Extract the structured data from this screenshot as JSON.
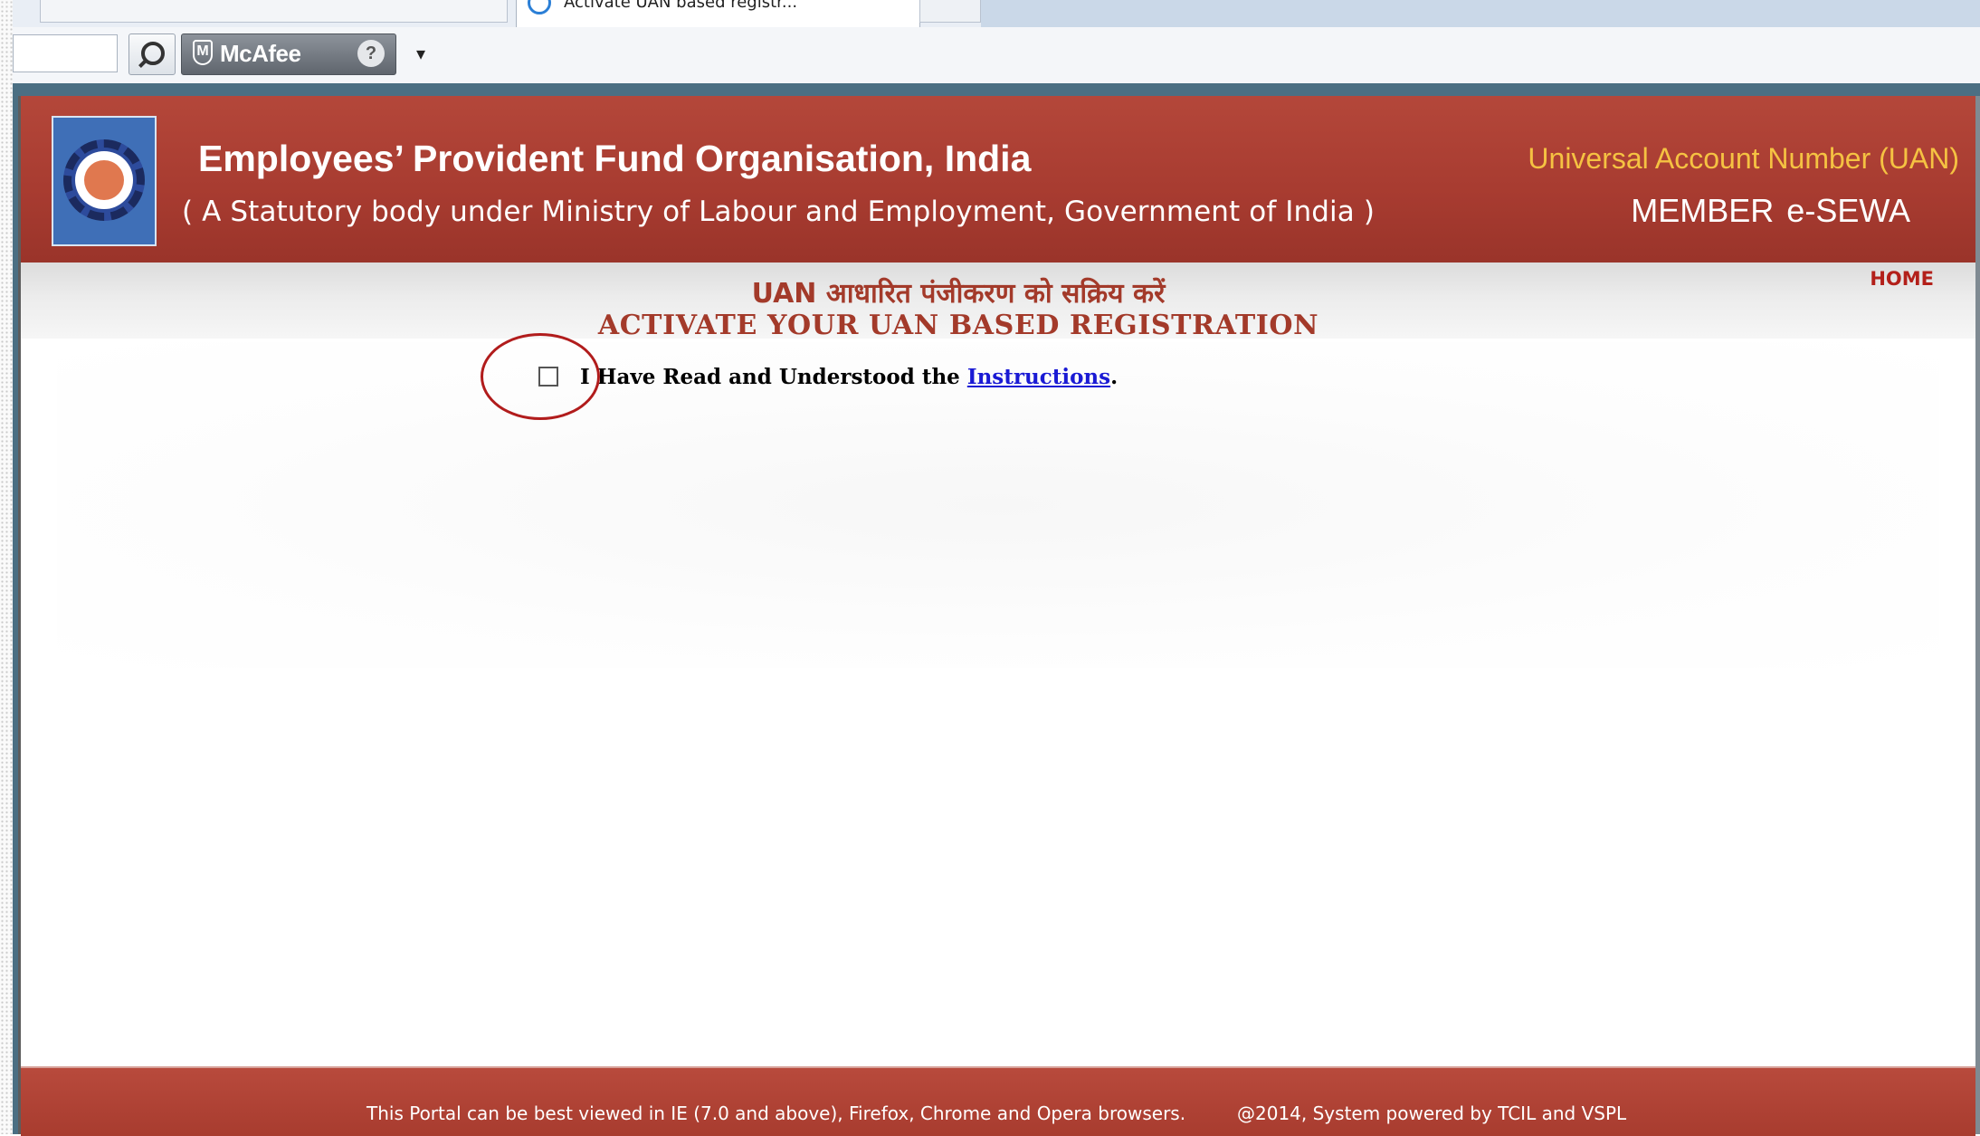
{
  "browser": {
    "active_tab_title": "Activate UAN based registr...",
    "toolbar": {
      "search_icon": "search-icon",
      "mcafee_label": "McAfee",
      "mcafee_shield": "M",
      "help_symbol": "?",
      "dropdown_symbol": "▾"
    }
  },
  "header": {
    "org_title": "Employees’ Provident Fund Organisation, India",
    "org_subtitle": "( A Statutory body under Ministry of Labour and Employment, Government of India )",
    "uan_label": "Universal Account Number (UAN)",
    "esewa_label": "MEMBER  e-SEWA"
  },
  "banner": {
    "hindi_heading": "UAN आधारित पंजीकरण को सक्रिय करें",
    "english_heading": "ACTIVATE YOUR UAN BASED REGISTRATION",
    "home_link": "HOME"
  },
  "form": {
    "agree_prefix": "I Have Read and Understood the ",
    "instructions_link": "Instructions",
    "agree_suffix": ".",
    "checkbox_checked": false
  },
  "footer": {
    "browser_note": "This Portal can be best viewed in IE (7.0 and above), Firefox, Chrome and Opera browsers.",
    "copyright": "@2014, System powered by TCIL and VSPL"
  },
  "colors": {
    "header_red": "#a73b30",
    "heading_red": "#a33a2a",
    "uan_gold": "#f5c242",
    "link_blue": "#1a1ad4",
    "annotation_red": "#b11c1c"
  }
}
